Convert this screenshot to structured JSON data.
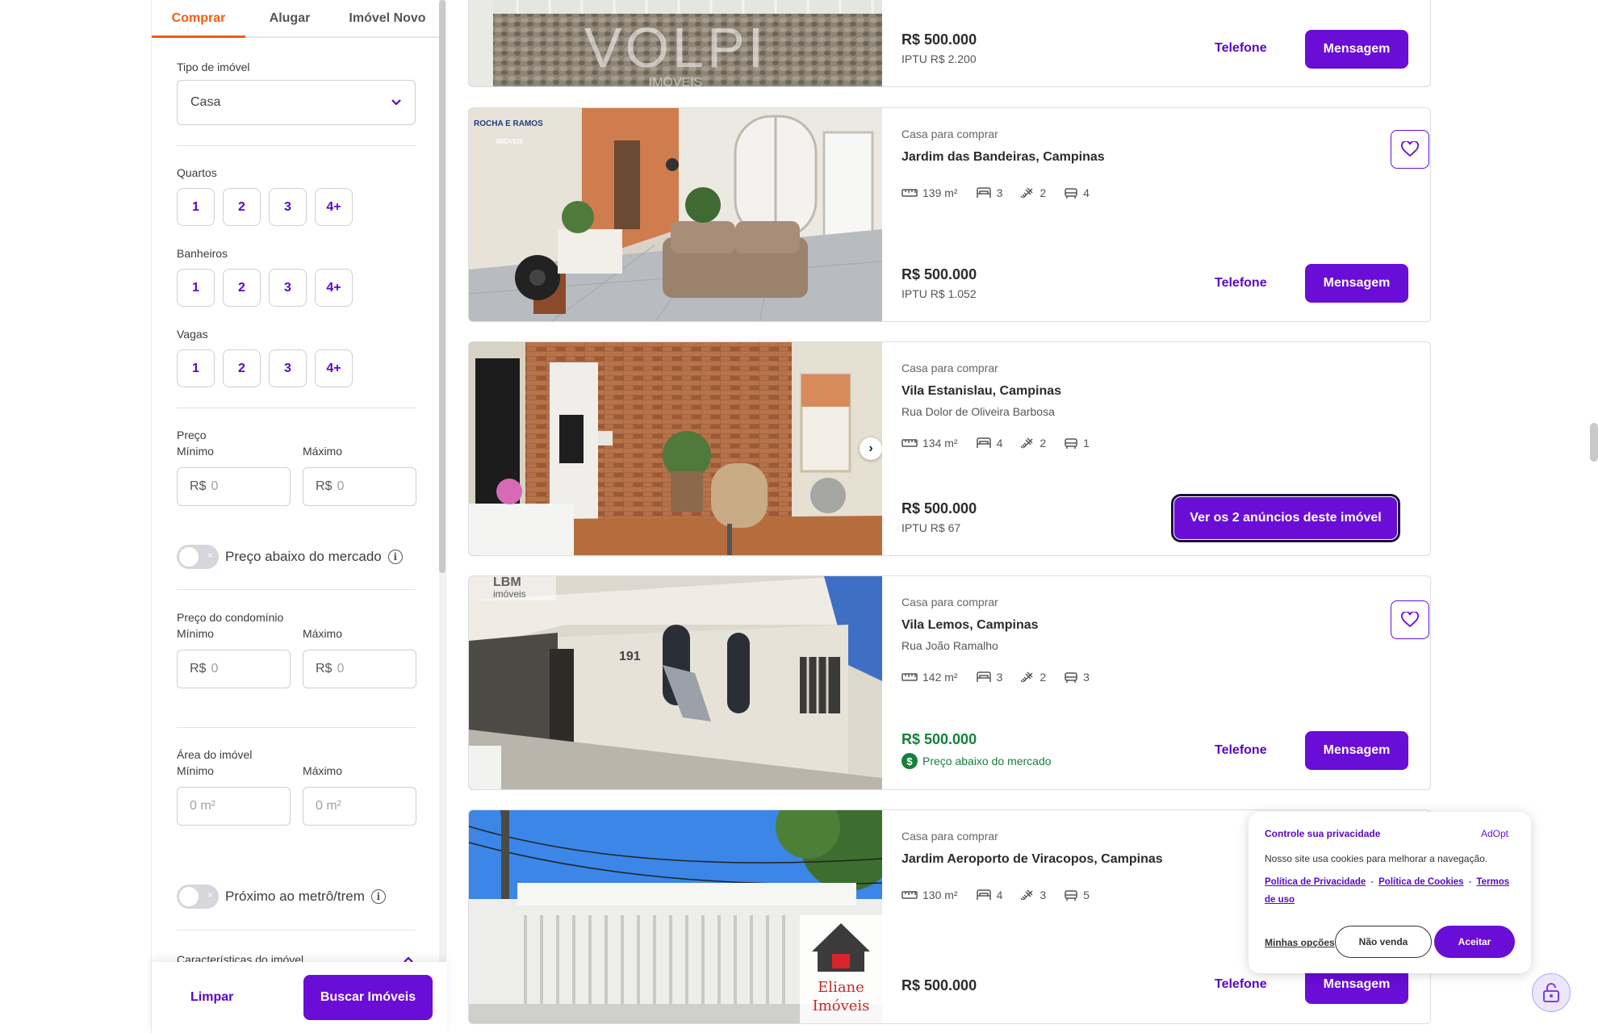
{
  "sidebar": {
    "tabs": [
      "Comprar",
      "Alugar",
      "Imóvel Novo"
    ],
    "property_type_label": "Tipo de imóvel",
    "property_type_value": "Casa",
    "rooms_label": "Quartos",
    "baths_label": "Banheiros",
    "parking_label": "Vagas",
    "counts": [
      "1",
      "2",
      "3",
      "4+"
    ],
    "price_label": "Preço",
    "min_label": "Mínimo",
    "max_label": "Máximo",
    "currency": "R$",
    "zero": "0",
    "below_market_label": "Preço abaixo do mercado",
    "condo_label": "Preço do condomínio",
    "area_label": "Área do imóvel",
    "area_placeholder": "0 m²",
    "metro_label": "Próximo ao metrô/trem",
    "features_label": "Características do imóvel",
    "clear_label": "Limpar",
    "search_label": "Buscar Imóveis",
    "info_glyph": "i",
    "toggle_glyph": "×"
  },
  "colors": {
    "accent": "#6a0dd6",
    "link": "#5a06c7",
    "tab_active": "#f25c0d",
    "below_market": "#16803b"
  },
  "listings": [
    {
      "price": "R$ 500.000",
      "iptu": "IPTU R$ 2.200",
      "phone_label": "Telefone",
      "message_label": "Mensagem",
      "watermark": "VOLPI",
      "watermark_sub": "IMÓVEIS"
    },
    {
      "type": "Casa para comprar",
      "location": "Jardim das Bandeiras, Campinas",
      "area": "139 m²",
      "bedrooms": "3",
      "bathrooms": "2",
      "parking": "4",
      "price": "R$ 500.000",
      "iptu": "IPTU R$ 1.052",
      "phone_label": "Telefone",
      "message_label": "Mensagem",
      "logo_text": "ROCHA E RAMOS",
      "logo_sub": "IMÓVEIS"
    },
    {
      "type": "Casa para comprar",
      "location": "Vila Estanislau, Campinas",
      "street": "Rua Dolor de Oliveira Barbosa",
      "area": "134 m²",
      "bedrooms": "4",
      "bathrooms": "2",
      "parking": "1",
      "price": "R$ 500.000",
      "iptu": "IPTU R$ 67",
      "multi_label": "Ver os 2 anúncios deste imóvel",
      "arrow": "›"
    },
    {
      "type": "Casa para comprar",
      "location": "Vila Lemos, Campinas",
      "street": "Rua João Ramalho",
      "area": "142 m²",
      "bedrooms": "3",
      "bathrooms": "2",
      "parking": "3",
      "price": "R$ 500.000",
      "below_market_label": "Preço abaixo do mercado",
      "dollar_glyph": "$",
      "phone_label": "Telefone",
      "message_label": "Mensagem",
      "logo_text": "LBM",
      "logo_sub": "imóveis",
      "house_number": "191"
    },
    {
      "type": "Casa para comprar",
      "location": "Jardim Aeroporto de Viracopos, Campinas",
      "area": "130 m²",
      "bedrooms": "4",
      "bathrooms": "3",
      "parking": "5",
      "price": "R$ 500.000",
      "phone_label": "Telefone",
      "message_label": "Mensagem",
      "logo_text": "Eliane",
      "logo_sub": "Imóveis"
    }
  ],
  "cookie": {
    "title": "Controle sua privacidade",
    "brand": "AdOpt",
    "description": "Nosso site usa cookies para melhorar a navegação.",
    "privacy_link": "Política de Privacidade",
    "cookies_link": "Política de Cookies",
    "terms_link": "Termos de uso",
    "separator": "-",
    "options_label": "Minhas opções",
    "no_sale_label": "Não venda",
    "accept_label": "Aceitar"
  }
}
